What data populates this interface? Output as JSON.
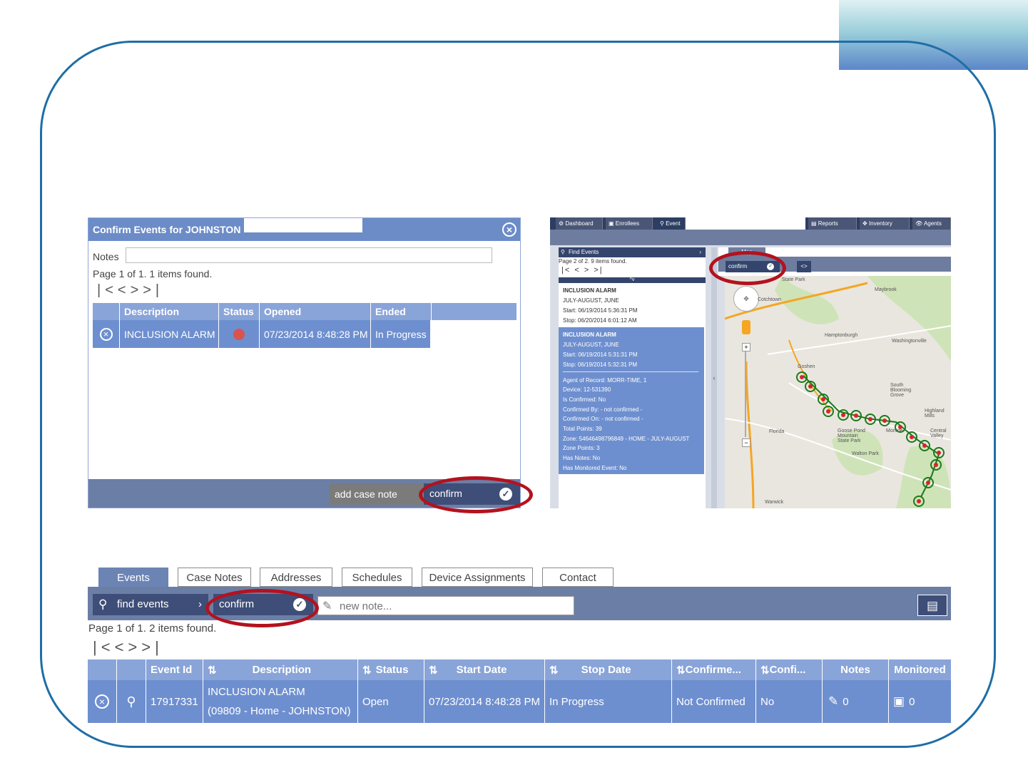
{
  "dialog": {
    "title": "Confirm Events for JOHNSTON",
    "notes_label": "Notes",
    "notes_value": "",
    "page_info": "Page 1 of 1. 1 items found.",
    "columns": [
      "Description",
      "Status",
      "Opened",
      "Ended"
    ],
    "row": {
      "description": "INCLUSION ALARM",
      "opened": "07/23/2014 8:48:28 PM",
      "ended": "In Progress",
      "status_color": "#d9534f"
    },
    "add_case_note": "add case note",
    "confirm": "confirm"
  },
  "app": {
    "nav_tabs": [
      "Dashboard",
      "Enrollees",
      "Event",
      "Reports",
      "Inventory",
      "Agents"
    ],
    "map_tab": "Map",
    "find_events": "Find Events",
    "page_info": "Page 2 of 2. 9 items found.",
    "confirm": "confirm",
    "event1": {
      "title": "INCLUSION ALARM",
      "zone": "JULY-AUGUST, JUNE",
      "start": "Start: 06/19/2014 5:36:31 PM",
      "stop": "Stop: 06/20/2014 6:01:12 AM"
    },
    "event2": {
      "title": "INCLUSION ALARM",
      "zone": "JULY-AUGUST, JUNE",
      "start": "Start: 06/19/2014 5:31:31 PM",
      "stop": "Stop: 06/19/2014 5:32:31 PM",
      "details": [
        "Agent of Record: MORR-TIME, 1",
        "Device: 12-531390",
        "Is Confirmed: No",
        "Confirmed By: - not confirmed -",
        "Confirmed On: - not confirmed -",
        "Total Points: 39",
        "Zone: 54646498796849 - HOME - JULY-AUGUST",
        "Zone Points: 3",
        "Has Notes: No",
        "Has Monitored Event: No"
      ]
    },
    "map_labels": [
      "State Park",
      "Maybrook",
      "Cotchtown",
      "Hamptonburgh",
      "Washingtonville",
      "Goshen",
      "South Blooming Grove",
      "Highland Mills",
      "Florida",
      "Goose Pond Mountain State Park",
      "Monroe",
      "Walton Park",
      "Warwick",
      "Central Valley"
    ],
    "route_color": "#1a7a1a"
  },
  "bottom": {
    "tabs": [
      "Events",
      "Case Notes",
      "Addresses",
      "Schedules",
      "Device Assignments",
      "Contact"
    ],
    "find_events": "find events",
    "confirm": "confirm",
    "new_note_placeholder": "new note...",
    "page_info": "Page 1 of 1. 2 items found.",
    "columns": [
      "Event Id",
      "Description",
      "Status",
      "Start Date",
      "Stop Date",
      "Confirme...",
      "Confi...",
      "Notes",
      "Monitored"
    ],
    "row": {
      "event_id": "17917331",
      "description_line1": "INCLUSION ALARM",
      "description_line2": "(09809 - Home - JOHNSTON)",
      "status": "Open",
      "start_date": "07/23/2014 8:48:28 PM",
      "stop_date": "In Progress",
      "confirmed": "Not Confirmed",
      "confi": "No",
      "notes": "0",
      "monitored": "0"
    }
  },
  "colors": {
    "frame": "#1f6ea6",
    "highlight": "#b3121e",
    "header": "#6c8cc8",
    "row": "#6e8fcf"
  }
}
